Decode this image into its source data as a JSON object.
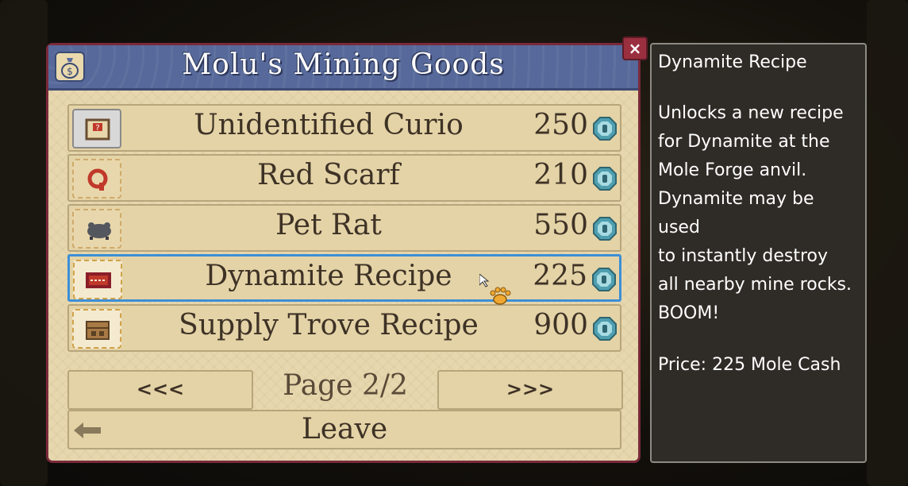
{
  "shop": {
    "title": "Molu's Mining Goods",
    "close_label": "×",
    "items": [
      {
        "name": "Unidentified Curio",
        "price": "250",
        "icon": "curio-chest-icon"
      },
      {
        "name": "Red Scarf",
        "price": "210",
        "icon": "red-scarf-icon"
      },
      {
        "name": "Pet Rat",
        "price": "550",
        "icon": "pet-rat-icon"
      },
      {
        "name": "Dynamite Recipe",
        "price": "225",
        "icon": "dynamite-recipe-icon",
        "selected": true
      },
      {
        "name": "Supply Trove Recipe",
        "price": "900",
        "icon": "supply-trove-recipe-icon"
      }
    ],
    "prev_label": "<<<",
    "next_label": ">>>",
    "page_label": "Page 2/2",
    "leave_label": "Leave"
  },
  "info": {
    "title": "Dynamite Recipe",
    "description": "Unlocks a new recipe\nfor Dynamite at the\nMole Forge anvil.\nDynamite may be used\nto instantly destroy\nall nearby mine rocks.\nBOOM!",
    "price": "Price: 225 Mole Cash"
  },
  "colors": {
    "panel": "#e7d7ae",
    "header": "#56699a",
    "border": "#7a2a3a",
    "selected": "#3c8fd6",
    "coin": "#4f9fb0",
    "info_bg": "#2f2b26"
  }
}
